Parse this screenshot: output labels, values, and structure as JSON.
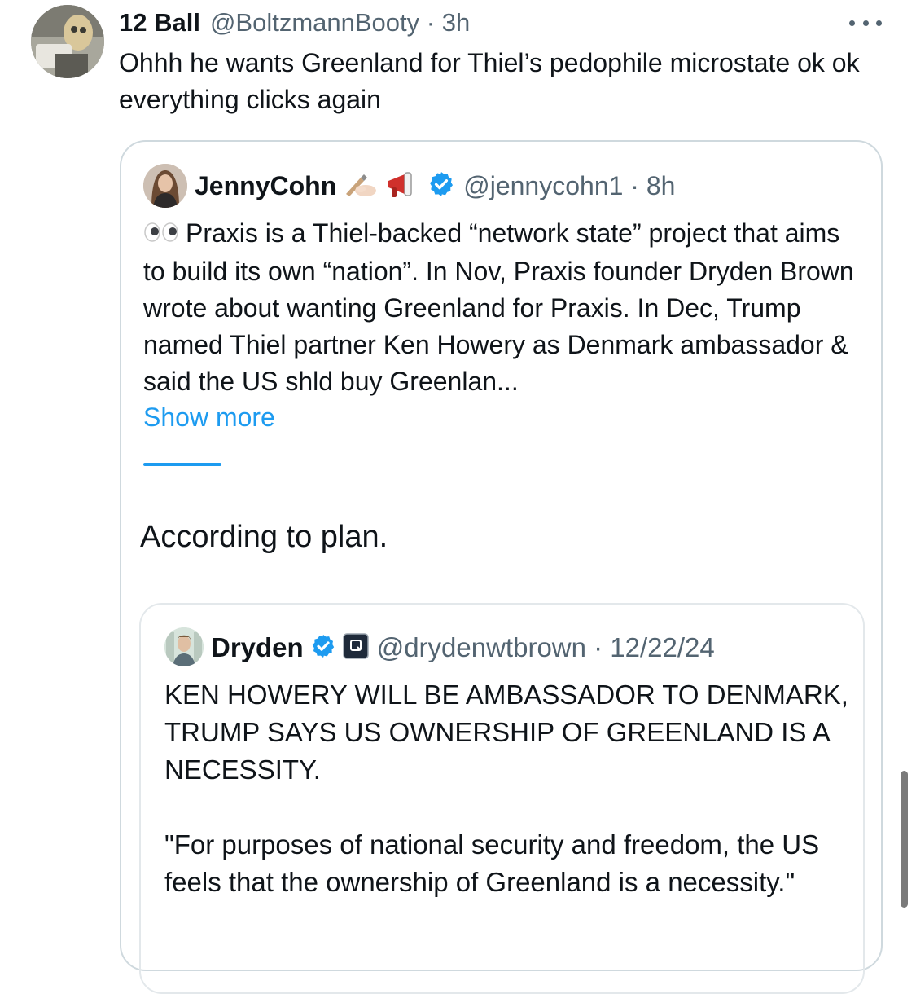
{
  "outer_tweet": {
    "name": "12 Ball",
    "handle": "@BoltzmannBooty · 3h",
    "text": "Ohhh he wants Greenland for Thiel’s pedophile microstate ok ok everything clicks again",
    "more_icon": "more-horizontal-icon"
  },
  "quoted_tweet": {
    "name": "JennyCohn",
    "handle": "@jennycohn1 · 8h",
    "name_emojis": [
      "writing-hand-icon",
      "megaphone-icon"
    ],
    "verified_icon": "verified-badge-icon",
    "leading_emoji": "eyes-icon",
    "text": "Praxis is a Thiel-backed “network state” project that aims to build its own “nation”. In Nov, Praxis founder Dryden Brown wrote about wanting Greenland for Praxis. In Dec, Trump named Thiel partner Ken Howery as Denmark ambassador & said the US shld buy Greenlan...",
    "show_more": "Show more",
    "subtext": "According to plan."
  },
  "nested_tweet": {
    "name": "Dryden",
    "handle": "@drydenwtbrown · 12/22/24",
    "verified_icon": "verified-badge-icon",
    "affiliate_icon": "affiliate-badge-icon",
    "text_line_1": "KEN HOWERY WILL BE AMBASSADOR TO DENMARK, TRUMP SAYS US OWNERSHIP OF GREENLAND IS A NECESSITY.",
    "text_line_2": "\"For purposes of national security and freedom, the US feels that the ownership of Greenland is a necessity.\""
  },
  "colors": {
    "link": "#1d9bf0",
    "secondary_text": "#536471",
    "primary_text": "#0f1419",
    "border": "#cfd9de"
  }
}
